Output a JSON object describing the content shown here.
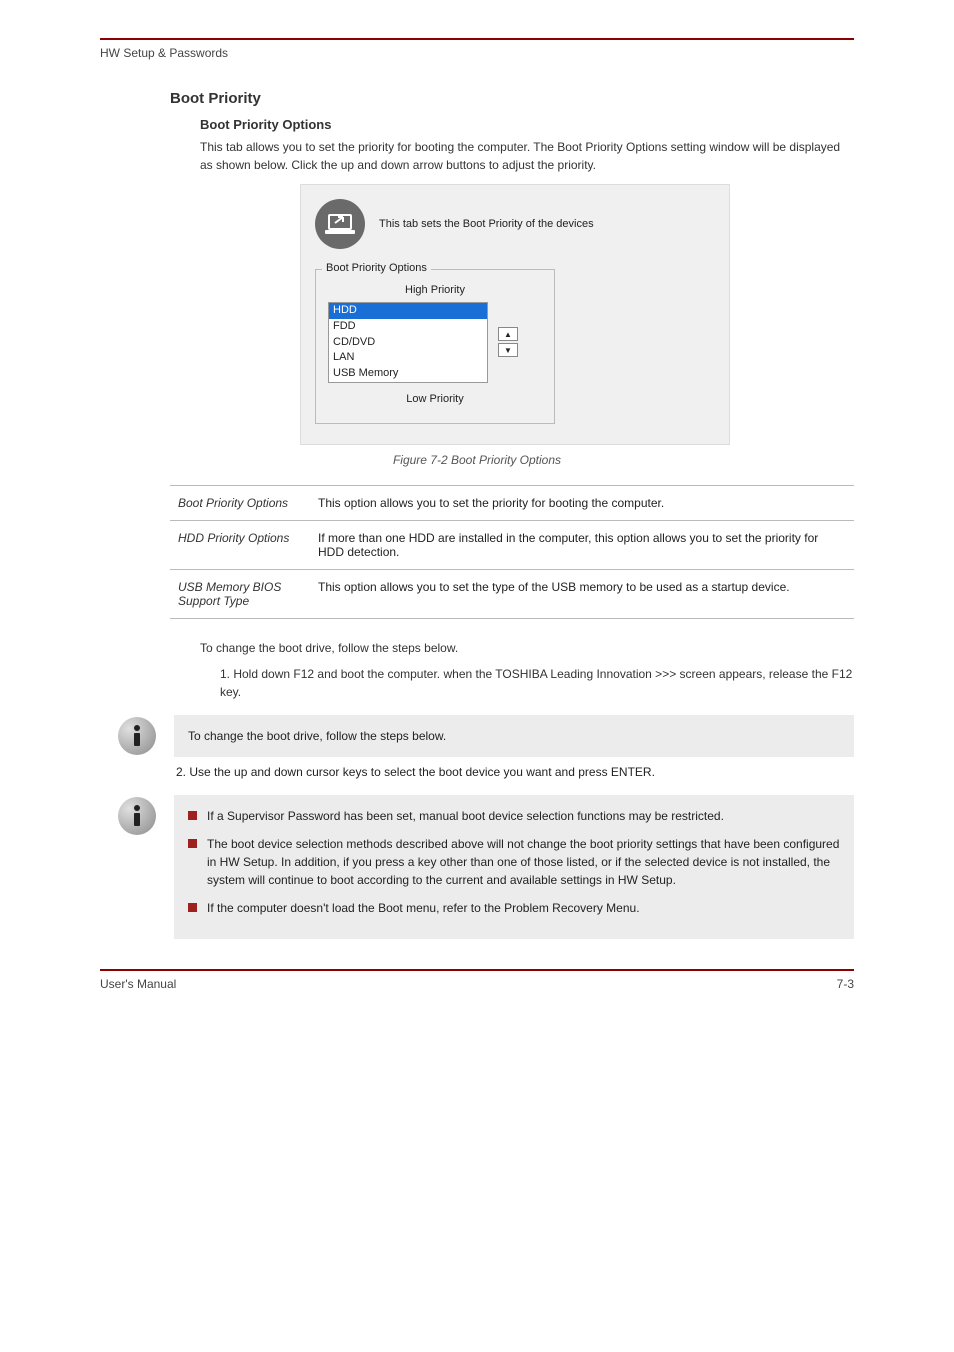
{
  "header": {
    "left": "HW Setup & Passwords",
    "right": ""
  },
  "section_title": "Boot Priority",
  "sub1_title": "Boot Priority Options",
  "sub1_body": "This tab allows you to set the priority for booting the computer. The Boot Priority Options setting window will be displayed as shown below. Click the up and down arrow buttons to adjust the priority.",
  "screenshot": {
    "caption": "This tab sets the Boot Priority of the devices",
    "legend": "Boot Priority Options",
    "high_label": "High Priority",
    "low_label": "Low Priority",
    "items": [
      "HDD",
      "FDD",
      "CD/DVD",
      "LAN",
      "USB Memory"
    ]
  },
  "figure_caption": "Figure 7-2 Boot Priority Options",
  "table": {
    "rows": [
      {
        "left": "Boot Priority Options",
        "right": "This option allows you to set the priority for booting the computer."
      },
      {
        "left": "HDD Priority Options",
        "right": "If more than one HDD are installed in the computer, this option allows you to set the priority for HDD detection."
      },
      {
        "left": "USB Memory BIOS Support Type",
        "right": "This option allows you to set the type of the USB memory to be used as a startup device."
      }
    ]
  },
  "override_text": "To change the boot drive, follow the steps below.",
  "step1": "1. Hold down F12 and boot the computer. when the TOSHIBA Leading Innovation >>> screen appears, release the F12 key.",
  "info1_body": "To change the boot drive, follow the steps below.",
  "info1_after": "2. Use the up and down cursor keys to select the boot device you want and press ENTER.",
  "info2": {
    "bullets": [
      "If a Supervisor Password has been set, manual boot device selection functions may be restricted.",
      "The boot device selection methods described above will not change the boot priority settings that have been configured in HW Setup. In addition, if you press a key other than one of those listed, or if the selected device is not installed, the system will continue to boot according to the current and available settings in HW Setup.",
      "If the computer doesn't load the Boot menu, refer to the Problem Recovery Menu."
    ]
  },
  "footer": {
    "left": "User's Manual",
    "right": "7-3"
  }
}
